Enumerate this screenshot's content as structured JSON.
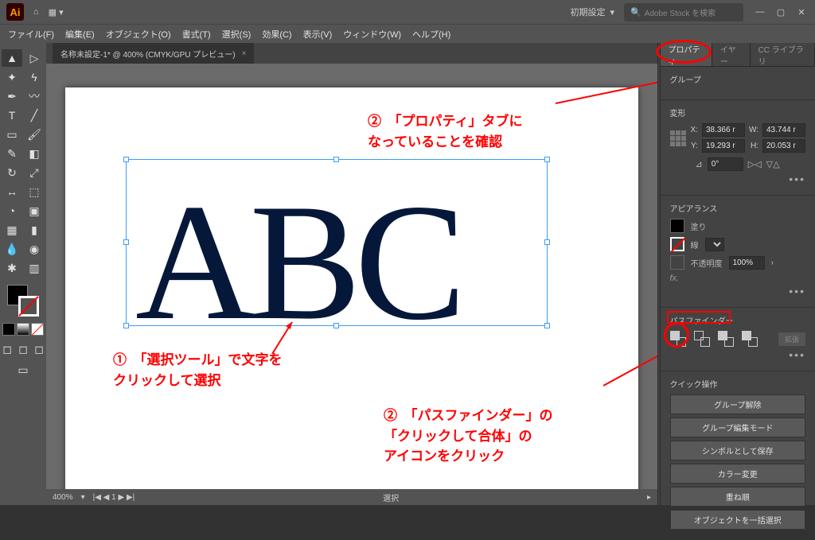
{
  "titlebar": {
    "workspace_label": "初期設定",
    "search_placeholder": "Adobe Stock を検索"
  },
  "menu": {
    "file": "ファイル(F)",
    "edit": "編集(E)",
    "object": "オブジェクト(O)",
    "type": "書式(T)",
    "select": "選択(S)",
    "effect": "効果(C)",
    "view": "表示(V)",
    "window": "ウィンドウ(W)",
    "help": "ヘルプ(H)"
  },
  "doc_tab": {
    "title": "名称未設定-1* @ 400% (CMYK/GPU プレビュー)",
    "close": "×"
  },
  "canvas": {
    "text": "ABC"
  },
  "annotations": {
    "a1": "①　「選択ツール」で文字を\nクリックして選択",
    "a2": "②　「プロパティ」タブに\nなっていることを確認",
    "a3": "②　「パスファインダー」の\n「クリックして合体」の\nアイコンをクリック"
  },
  "status": {
    "zoom": "400%",
    "tool": "選択"
  },
  "panels": {
    "tabs": {
      "properties": "プロパティ",
      "layers": "イヤー",
      "cc": "CC ライブラリ"
    },
    "group_title": "グループ",
    "transform": {
      "title": "変形",
      "x_label": "X:",
      "x_val": "38.366 r",
      "y_label": "Y:",
      "y_val": "19.293 r",
      "w_label": "W:",
      "w_val": "43.744 r",
      "h_label": "H:",
      "h_val": "20.053 r",
      "rotate_val": "0°"
    },
    "appearance": {
      "title": "アピアランス",
      "fill": "塗り",
      "stroke": "線",
      "opacity_label": "不透明度",
      "opacity_val": "100%"
    },
    "pathfinder": {
      "title": "パスファインダー",
      "expand": "拡張"
    },
    "quick": {
      "title": "クイック操作",
      "ungroup": "グループ解除",
      "isolate": "グループ編集モード",
      "save_symbol": "シンボルとして保存",
      "recolor": "カラー変更",
      "arrange": "重ね順",
      "select_all": "オブジェクトを一括選択"
    }
  }
}
